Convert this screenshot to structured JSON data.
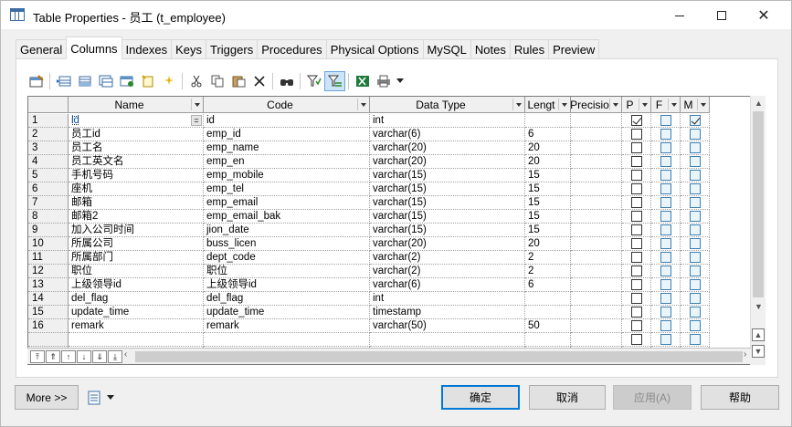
{
  "window": {
    "title": "Table Properties - 员工 (t_employee)"
  },
  "tabs": [
    "General",
    "Columns",
    "Indexes",
    "Keys",
    "Triggers",
    "Procedures",
    "Physical Options",
    "MySQL",
    "Notes",
    "Rules",
    "Preview"
  ],
  "active_tab": "Columns",
  "toolbar": {
    "icons": [
      "properties-icon",
      "insert-row-icon",
      "add-row-icon",
      "add-columns-icon",
      "copy-columns-icon",
      "new-icon",
      "cut-icon",
      "copy-icon",
      "paste-icon",
      "delete-icon",
      "find-icon",
      "filter-icon",
      "filter-active-icon",
      "excel-export-icon",
      "print-icon",
      "dropdown-arrow-icon"
    ]
  },
  "grid": {
    "columns": [
      "Name",
      "Code",
      "Data Type",
      "Lengt",
      "Precisio",
      "P",
      "F",
      "M"
    ],
    "rows": [
      {
        "n": "1",
        "name": "id",
        "code": "id",
        "type": "int",
        "len": "",
        "prec": "",
        "p": true,
        "f": false,
        "m": true
      },
      {
        "n": "2",
        "name": "员工id",
        "code": "emp_id",
        "type": "varchar(6)",
        "len": "6",
        "prec": "",
        "p": false,
        "f": false,
        "m": false
      },
      {
        "n": "3",
        "name": "员工名",
        "code": "emp_name",
        "type": "varchar(20)",
        "len": "20",
        "prec": "",
        "p": false,
        "f": false,
        "m": false
      },
      {
        "n": "4",
        "name": "员工英文名",
        "code": "emp_en",
        "type": "varchar(20)",
        "len": "20",
        "prec": "",
        "p": false,
        "f": false,
        "m": false
      },
      {
        "n": "5",
        "name": "手机号码",
        "code": "emp_mobile",
        "type": "varchar(15)",
        "len": "15",
        "prec": "",
        "p": false,
        "f": false,
        "m": false
      },
      {
        "n": "6",
        "name": "座机",
        "code": "emp_tel",
        "type": "varchar(15)",
        "len": "15",
        "prec": "",
        "p": false,
        "f": false,
        "m": false
      },
      {
        "n": "7",
        "name": "邮箱",
        "code": "emp_email",
        "type": "varchar(15)",
        "len": "15",
        "prec": "",
        "p": false,
        "f": false,
        "m": false
      },
      {
        "n": "8",
        "name": "邮箱2",
        "code": "emp_email_bak",
        "type": "varchar(15)",
        "len": "15",
        "prec": "",
        "p": false,
        "f": false,
        "m": false
      },
      {
        "n": "9",
        "name": "加入公司时间",
        "code": "jion_date",
        "type": "varchar(15)",
        "len": "15",
        "prec": "",
        "p": false,
        "f": false,
        "m": false
      },
      {
        "n": "10",
        "name": "所属公司",
        "code": "buss_licen",
        "type": "varchar(20)",
        "len": "20",
        "prec": "",
        "p": false,
        "f": false,
        "m": false
      },
      {
        "n": "11",
        "name": "所属部门",
        "code": "dept_code",
        "type": "varchar(2)",
        "len": "2",
        "prec": "",
        "p": false,
        "f": false,
        "m": false
      },
      {
        "n": "12",
        "name": "职位",
        "code": "职位",
        "type": "varchar(2)",
        "len": "2",
        "prec": "",
        "p": false,
        "f": false,
        "m": false
      },
      {
        "n": "13",
        "name": "上级领导id",
        "code": "上级领导id",
        "type": "varchar(6)",
        "len": "6",
        "prec": "",
        "p": false,
        "f": false,
        "m": false
      },
      {
        "n": "14",
        "name": "del_flag",
        "code": "del_flag",
        "type": "int",
        "len": "",
        "prec": "",
        "p": false,
        "f": false,
        "m": false
      },
      {
        "n": "15",
        "name": "update_time",
        "code": "update_time",
        "type": "timestamp",
        "len": "",
        "prec": "",
        "p": false,
        "f": false,
        "m": false
      },
      {
        "n": "16",
        "name": "remark",
        "code": "remark",
        "type": "varchar(50)",
        "len": "50",
        "prec": "",
        "p": false,
        "f": false,
        "m": false
      }
    ],
    "empty_rows": 2,
    "first_cell_button": "="
  },
  "nav_buttons": [
    "⤒",
    "⇑",
    "↑",
    "↓",
    "⇓",
    "⤓"
  ],
  "buttons": {
    "more": "More >>",
    "ok": "确定",
    "cancel": "取消",
    "apply": "应用(A)",
    "help": "帮助"
  },
  "colors": {
    "accent": "#0078d7",
    "selected_text": "#0b5bd3"
  }
}
